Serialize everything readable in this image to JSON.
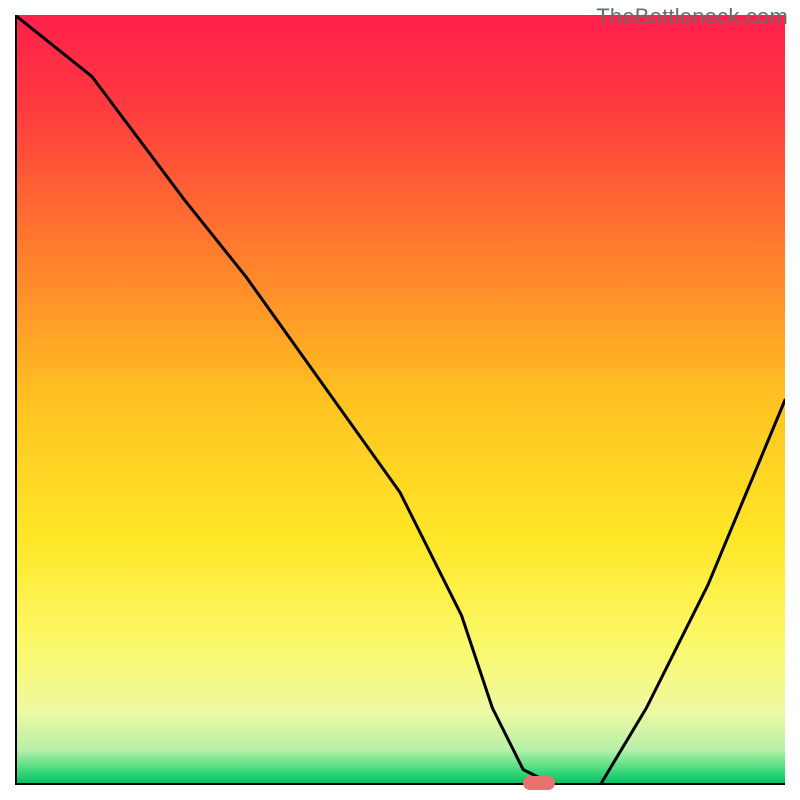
{
  "watermark": {
    "text": "TheBottleneck.com"
  },
  "chart_data": {
    "type": "line",
    "title": "",
    "xlabel": "",
    "ylabel": "",
    "xlim": [
      0,
      100
    ],
    "ylim": [
      0,
      100
    ],
    "x": [
      0,
      10,
      22,
      30,
      40,
      50,
      58,
      62,
      66,
      70,
      76,
      82,
      90,
      100
    ],
    "values": [
      100,
      92,
      76,
      66,
      52,
      38,
      22,
      10,
      2,
      0,
      0,
      10,
      26,
      50
    ],
    "background_gradient": {
      "stops": [
        {
          "offset": 0.0,
          "color": "#ff1f4b"
        },
        {
          "offset": 0.12,
          "color": "#ff3b3f"
        },
        {
          "offset": 0.3,
          "color": "#ff7a2e"
        },
        {
          "offset": 0.5,
          "color": "#ffc221"
        },
        {
          "offset": 0.68,
          "color": "#ffe727"
        },
        {
          "offset": 0.82,
          "color": "#fbf96b"
        },
        {
          "offset": 0.905,
          "color": "#eef9a3"
        },
        {
          "offset": 0.955,
          "color": "#b6f0a8"
        },
        {
          "offset": 0.985,
          "color": "#2fd676"
        },
        {
          "offset": 1.0,
          "color": "#08b760"
        }
      ]
    },
    "marker": {
      "x": 68,
      "y": 0,
      "color": "#e8736e"
    },
    "axes": {
      "color": "#000000",
      "width": 4
    },
    "series_style": {
      "color": "#000000",
      "width": 3
    }
  }
}
